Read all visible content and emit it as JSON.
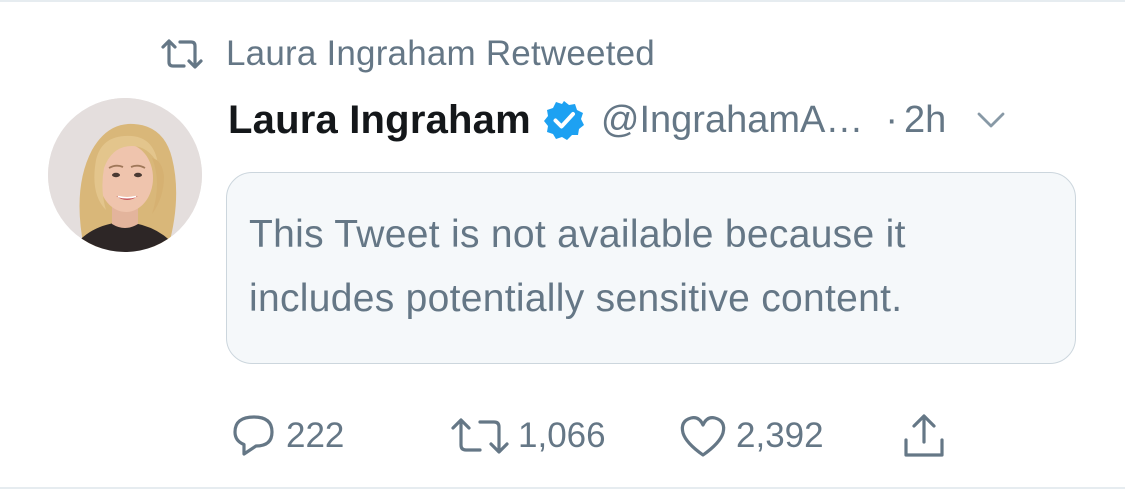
{
  "context": {
    "text": "Laura Ingraham Retweeted",
    "icon": "retweet-icon"
  },
  "author": {
    "display_name": "Laura Ingraham",
    "verified": true,
    "handle": "@IngrahamA…",
    "separator": "·",
    "time": "2h"
  },
  "notice": {
    "text": "This Tweet is not available because it includes potentially sensitive content."
  },
  "actions": {
    "reply_count": "222",
    "retweet_count": "1,066",
    "like_count": "2,392"
  },
  "colors": {
    "secondary_text": "#657786",
    "primary_text": "#14171a",
    "verified_blue": "#1da1f2",
    "notice_bg": "#f5f8fa",
    "border": "#ccd6dd"
  }
}
